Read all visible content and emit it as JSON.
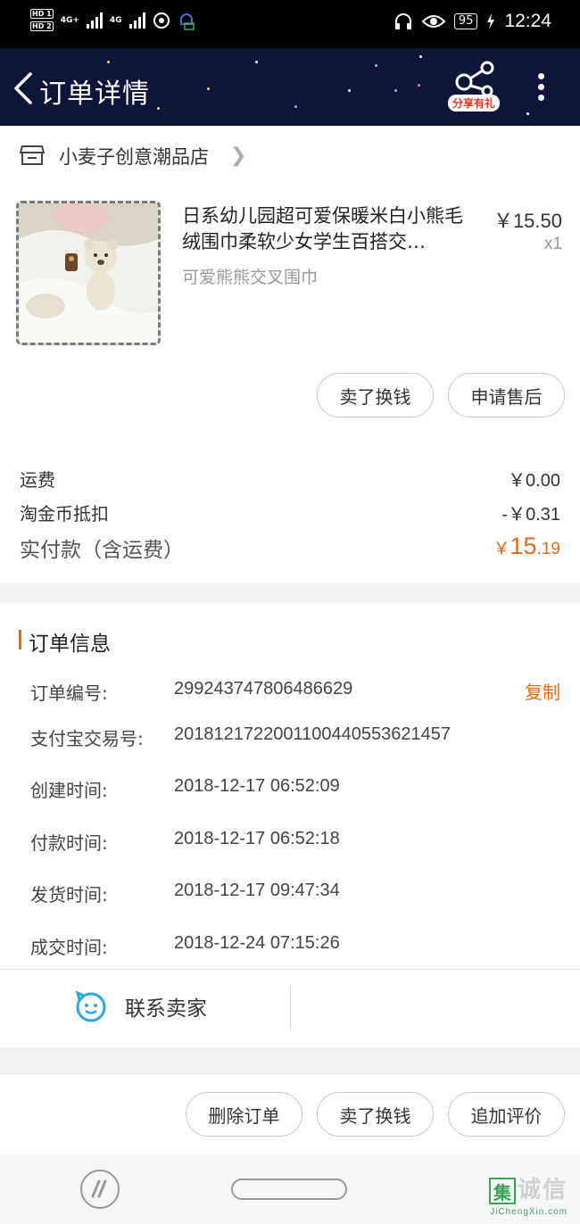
{
  "status_bar": {
    "hd1": "HD 1",
    "hd2": "HD 2",
    "net1": "4G+",
    "net2": "4G",
    "battery": "95",
    "time": "12:24"
  },
  "header": {
    "title": "订单详情",
    "share_badge": "分享有礼"
  },
  "shop": {
    "name": "小麦子创意潮品店"
  },
  "product": {
    "title": "日系幼儿园超可爱保暖米白小熊毛绒围巾柔软少女学生百搭交…",
    "price": "￥15.50",
    "qty": "x1",
    "sku": "可爱熊熊交叉围巾"
  },
  "product_actions": {
    "sell": "卖了换钱",
    "after_sale": "申请售后"
  },
  "fees": {
    "shipping_label": "运费",
    "shipping_value": "￥0.00",
    "coin_label": "淘金币抵扣",
    "coin_value": "-￥0.31",
    "total_label": "实付款（含运费）",
    "total_symbol": "￥",
    "total_int": "15",
    "total_dec": ".19"
  },
  "order_info": {
    "title": "订单信息",
    "copy": "复制",
    "rows": [
      {
        "label": "订单编号:",
        "value": "299243747806486629"
      },
      {
        "label": "支付宝交易号:",
        "value": "2018121722001100440553621457"
      },
      {
        "label": "创建时间:",
        "value": "2018-12-17 06:52:09"
      },
      {
        "label": "付款时间:",
        "value": "2018-12-17 06:52:18"
      },
      {
        "label": "发货时间:",
        "value": "2018-12-17 09:47:34"
      },
      {
        "label": "成交时间:",
        "value": "2018-12-24 07:15:26"
      }
    ],
    "contact": "联系卖家"
  },
  "bottom_actions": {
    "delete": "删除订单",
    "sell": "卖了换钱",
    "review": "追加评价"
  },
  "watermark": {
    "box": "集",
    "text": "诚信",
    "sub": "JiChengXin.com"
  },
  "colors": {
    "accent": "#e46a1b",
    "header_bg": "#0f1439"
  }
}
